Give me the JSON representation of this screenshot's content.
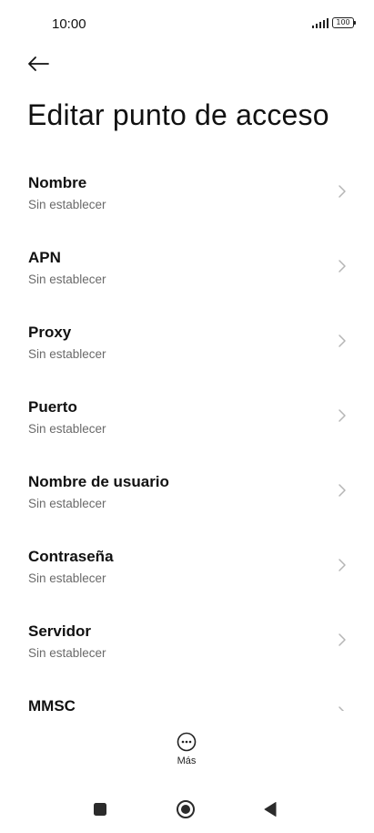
{
  "status_bar": {
    "time": "10:00",
    "battery": "100"
  },
  "header": {
    "title": "Editar punto de acceso"
  },
  "items": [
    {
      "label": "Nombre",
      "value": "Sin establecer"
    },
    {
      "label": "APN",
      "value": "Sin establecer"
    },
    {
      "label": "Proxy",
      "value": "Sin establecer"
    },
    {
      "label": "Puerto",
      "value": "Sin establecer"
    },
    {
      "label": "Nombre de usuario",
      "value": "Sin establecer"
    },
    {
      "label": "Contraseña",
      "value": "Sin establecer"
    },
    {
      "label": "Servidor",
      "value": "Sin establecer"
    },
    {
      "label": "MMSC",
      "value": ""
    }
  ],
  "footer": {
    "more_label": "Más"
  },
  "icons": {
    "back": "arrow-left-icon",
    "chevron": "chevron-right-icon",
    "more": "more-horizontal-icon",
    "signal": "signal-icon",
    "battery": "battery-icon",
    "nav_recents": "square-icon",
    "nav_home": "circle-icon",
    "nav_back": "triangle-left-icon"
  },
  "colors": {
    "background": "#ffffff",
    "text_primary": "#111111",
    "text_secondary": "#6a6a6a",
    "chevron": "#b5b5b5",
    "nav_icons": "#2b2b2b"
  }
}
